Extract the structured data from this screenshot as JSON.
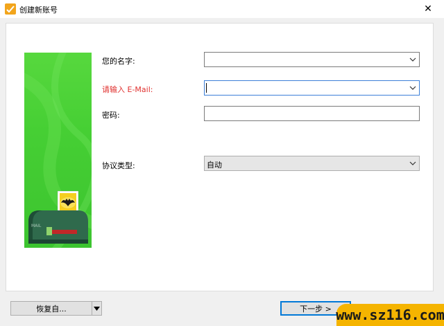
{
  "window": {
    "title": "创建新账号",
    "close_glyph": "✕"
  },
  "form": {
    "name_label": "您的名字:",
    "name_value": "",
    "email_label": "请输入 E-Mail:",
    "email_value": "",
    "password_label": "密码:",
    "password_value": "",
    "protocol_label": "协议类型:",
    "protocol_value": "自动"
  },
  "buttons": {
    "restore_label": "恢复自...",
    "next_label": "下一步 >"
  },
  "watermark": {
    "text": "www.sz116.com"
  },
  "colors": {
    "banner_green": "#46cf34",
    "email_label_red": "#e0312f",
    "focus_blue": "#3c7fd8",
    "watermark_yellow": "#f5b400"
  },
  "icons": {
    "app": "foxmail-app-icon",
    "mailbox": "mailbox-icon",
    "stamp": "bat-stamp-icon",
    "dropdown": "chevron-down-icon"
  }
}
